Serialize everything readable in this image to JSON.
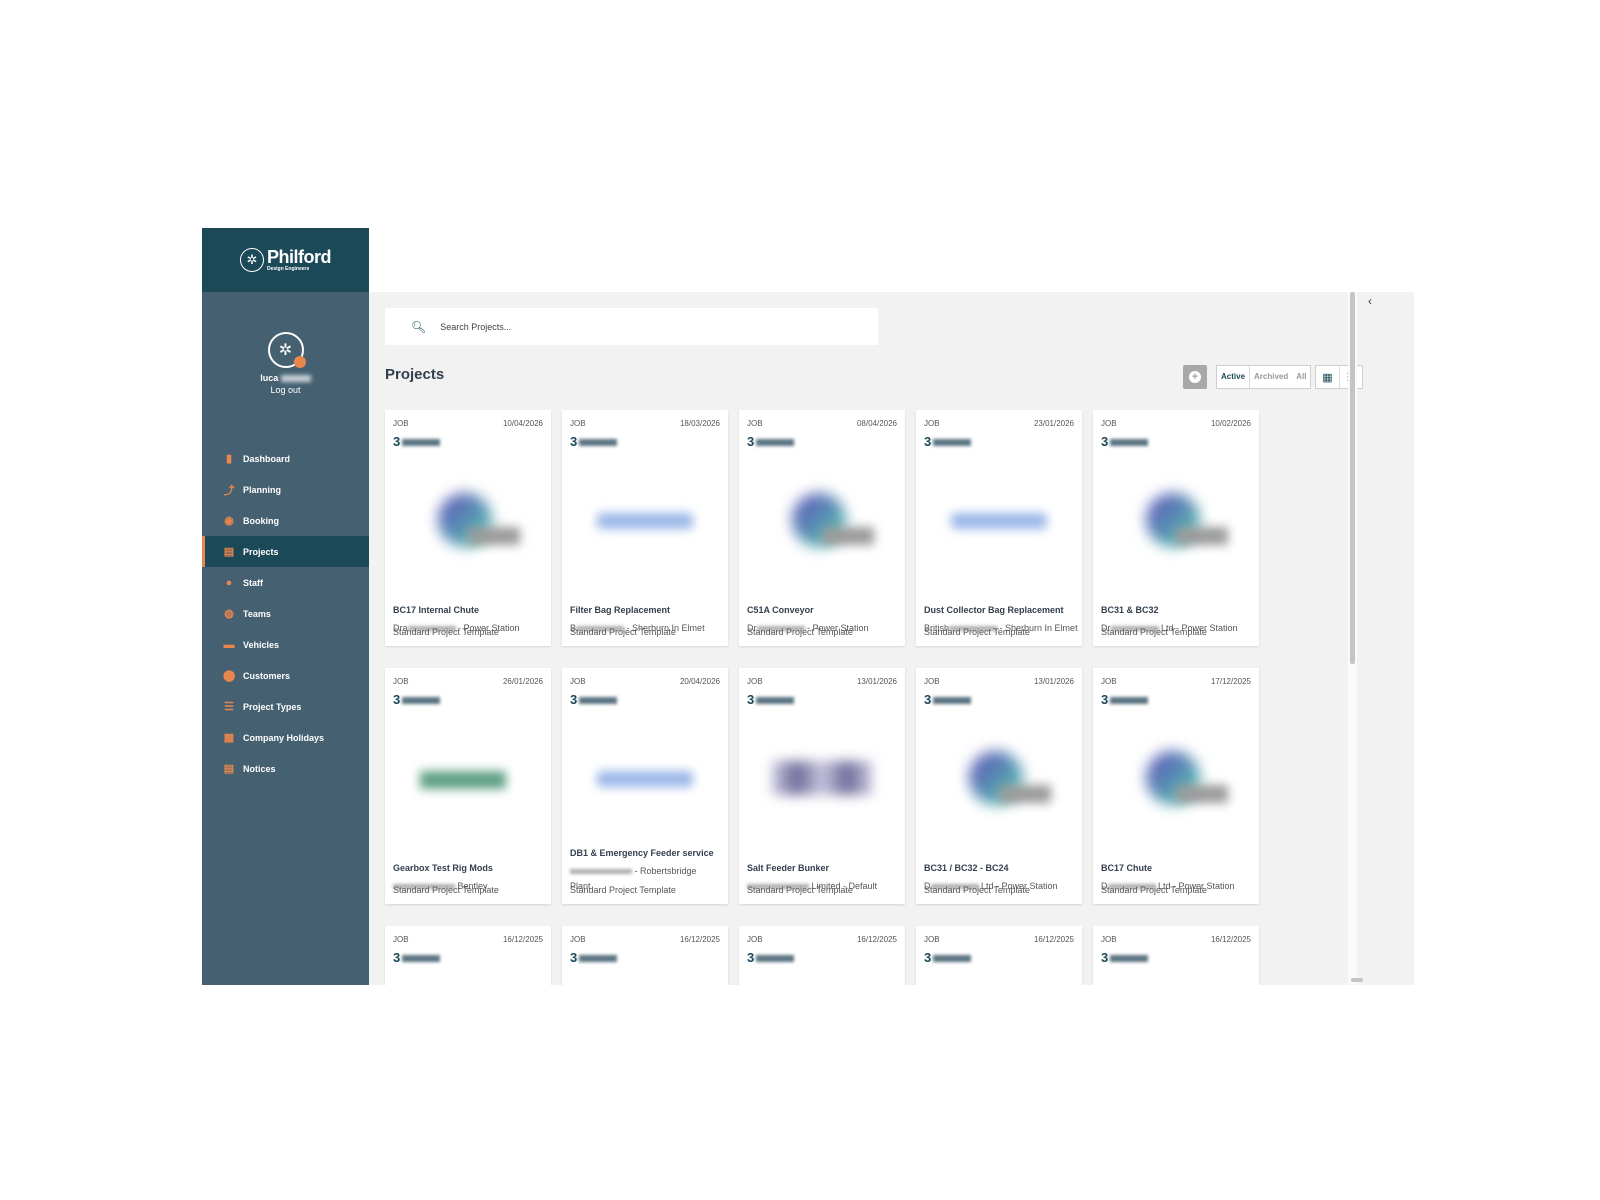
{
  "brand": {
    "name": "Philford",
    "subtitle": "Design Engineers"
  },
  "user": {
    "first_name": "luca",
    "logout_label": "Log out"
  },
  "nav": [
    {
      "label": "Dashboard",
      "icon": "bar-chart-icon"
    },
    {
      "label": "Planning",
      "icon": "trend-line-icon"
    },
    {
      "label": "Booking",
      "icon": "palette-icon"
    },
    {
      "label": "Projects",
      "icon": "clipboard-icon",
      "active": true
    },
    {
      "label": "Staff",
      "icon": "person-icon"
    },
    {
      "label": "Teams",
      "icon": "people-icon"
    },
    {
      "label": "Vehicles",
      "icon": "truck-icon"
    },
    {
      "label": "Customers",
      "icon": "map-pin-icon"
    },
    {
      "label": "Project Types",
      "icon": "list-icon"
    },
    {
      "label": "Company Holidays",
      "icon": "calendar-icon"
    },
    {
      "label": "Notices",
      "icon": "notice-icon"
    }
  ],
  "search": {
    "placeholder": "Search Projects..."
  },
  "page": {
    "title": "Projects"
  },
  "filters": [
    "Active",
    "Archived",
    "All"
  ],
  "active_filter": "Active",
  "colors": {
    "brand_dark": "#1c4958",
    "sidebar": "#456070",
    "accent": "#e8864d",
    "content_bg": "#f2f2f2"
  },
  "cards": [
    {
      "type": "JOB",
      "date": "10/04/2026",
      "number_prefix": "3",
      "title": "BC17 Internal Chute",
      "customer_prefix": "Dra",
      "customer_suffix": "- Power Station",
      "customer_extra": "",
      "template": "Standard Project Template",
      "logo": "round"
    },
    {
      "type": "JOB",
      "date": "18/03/2026",
      "number_prefix": "3",
      "title": "Filter Bag Replacement",
      "customer_prefix": "B",
      "customer_suffix": "- Sherburn In Elmet",
      "customer_extra": "",
      "template": "Standard Project Template",
      "logo": "pill"
    },
    {
      "type": "JOB",
      "date": "08/04/2026",
      "number_prefix": "3",
      "title": "C51A Conveyor",
      "customer_prefix": "Dr",
      "customer_suffix": "- Power Station",
      "customer_extra": "",
      "template": "Standard Project Template",
      "logo": "round"
    },
    {
      "type": "JOB",
      "date": "23/01/2026",
      "number_prefix": "3",
      "title": "Dust Collector Bag Replacement",
      "customer_prefix": "British",
      "customer_suffix": "- Sherburn In Elmet",
      "customer_extra": "",
      "template": "Standard Project Template",
      "logo": "pill"
    },
    {
      "type": "JOB",
      "date": "10/02/2026",
      "number_prefix": "3",
      "title": "BC31 & BC32",
      "customer_prefix": "Dr",
      "customer_suffix": "Ltd - Power Station",
      "customer_extra": "",
      "template": "Standard Project Template",
      "logo": "round"
    },
    {
      "type": "JOB",
      "date": "26/01/2026",
      "number_prefix": "3",
      "title": "Gearbox Test Rig Mods",
      "customer_prefix": "",
      "customer_suffix": "Bentley",
      "customer_extra": "",
      "template": "Standard Project Template",
      "logo": "green"
    },
    {
      "type": "JOB",
      "date": "20/04/2026",
      "number_prefix": "3",
      "title": "DB1 & Emergency Feeder service",
      "customer_prefix": "",
      "customer_suffix": "- Robertsbridge",
      "customer_extra": "Plant",
      "template": "Standard Project Template",
      "logo": "pill"
    },
    {
      "type": "JOB",
      "date": "13/01/2026",
      "number_prefix": "3",
      "title": "Salt Feeder Bunker",
      "customer_prefix": "",
      "customer_suffix": "Limited - Default",
      "customer_extra": "",
      "template": "Standard Project Template",
      "logo": "dots"
    },
    {
      "type": "JOB",
      "date": "13/01/2026",
      "number_prefix": "3",
      "title": "BC31 / BC32 - BC24",
      "customer_prefix": "D",
      "customer_suffix": "Ltd - Power Station",
      "customer_extra": "",
      "template": "Standard Project Template",
      "logo": "round"
    },
    {
      "type": "JOB",
      "date": "17/12/2025",
      "number_prefix": "3",
      "title": "BC17 Chute",
      "customer_prefix": "D",
      "customer_suffix": "Ltd - Power Station",
      "customer_extra": "",
      "template": "Standard Project Template",
      "logo": "round"
    },
    {
      "type": "JOB",
      "date": "16/12/2025",
      "number_prefix": "3"
    },
    {
      "type": "JOB",
      "date": "16/12/2025",
      "number_prefix": "3"
    },
    {
      "type": "JOB",
      "date": "16/12/2025",
      "number_prefix": "3"
    },
    {
      "type": "JOB",
      "date": "16/12/2025",
      "number_prefix": "3"
    },
    {
      "type": "JOB",
      "date": "16/12/2025",
      "number_prefix": "3"
    }
  ]
}
